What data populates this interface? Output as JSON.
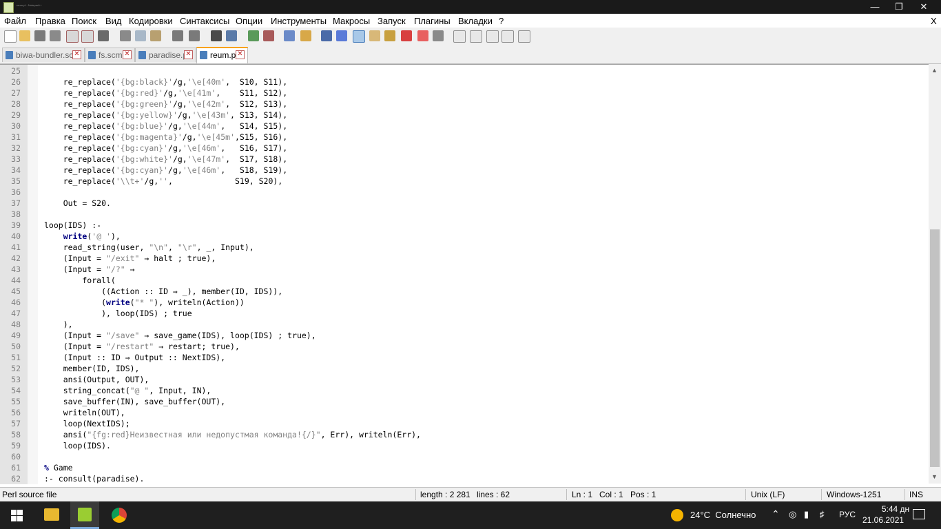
{
  "window": {
    "title": "reum.pl - Notepad++"
  },
  "menu": [
    "Файл",
    "Правка",
    "Поиск",
    "Вид",
    "Кодировки",
    "Синтаксисы",
    "Опции",
    "Инструменты",
    "Макросы",
    "Запуск",
    "Плагины",
    "Вкладки",
    "?"
  ],
  "menu_close": "X",
  "tabs": [
    {
      "label": "biwa-bundler.scm"
    },
    {
      "label": "fs.scm"
    },
    {
      "label": "paradise.pl"
    },
    {
      "label": "reum.pl"
    }
  ],
  "lines": [
    {
      "n": "25",
      "h": ""
    },
    {
      "n": "26",
      "h": "    re_replace(<span class=\"s\">'{bg:black}'</span>/g,<span class=\"s\">'\\e[40m'</span>,  S10, S11),"
    },
    {
      "n": "27",
      "h": "    re_replace(<span class=\"s\">'{bg:red}'</span>/g,<span class=\"s\">'\\e[41m'</span>,    S11, S12),"
    },
    {
      "n": "28",
      "h": "    re_replace(<span class=\"s\">'{bg:green}'</span>/g,<span class=\"s\">'\\e[42m'</span>,  S12, S13),"
    },
    {
      "n": "29",
      "h": "    re_replace(<span class=\"s\">'{bg:yellow}'</span>/g,<span class=\"s\">'\\e[43m'</span>, S13, S14),"
    },
    {
      "n": "30",
      "h": "    re_replace(<span class=\"s\">'{bg:blue}'</span>/g,<span class=\"s\">'\\e[44m'</span>,   S14, S15),"
    },
    {
      "n": "31",
      "h": "    re_replace(<span class=\"s\">'{bg:magenta}'</span>/g,<span class=\"s\">'\\e[45m'</span>,S15, S16),"
    },
    {
      "n": "32",
      "h": "    re_replace(<span class=\"s\">'{bg:cyan}'</span>/g,<span class=\"s\">'\\e[46m'</span>,   S16, S17),"
    },
    {
      "n": "33",
      "h": "    re_replace(<span class=\"s\">'{bg:white}'</span>/g,<span class=\"s\">'\\e[47m'</span>,  S17, S18),"
    },
    {
      "n": "34",
      "h": "    re_replace(<span class=\"s\">'{bg:cyan}'</span>/g,<span class=\"s\">'\\e[46m'</span>,   S18, S19),"
    },
    {
      "n": "35",
      "h": "    re_replace(<span class=\"s\">'\\\\t+'</span>/g,<span class=\"s\">''</span>,             S19, S20),"
    },
    {
      "n": "36",
      "h": ""
    },
    {
      "n": "37",
      "h": "    Out = S20."
    },
    {
      "n": "38",
      "h": ""
    },
    {
      "n": "39",
      "h": "loop(IDS) :-"
    },
    {
      "n": "40",
      "h": "    <span class=\"k\">write</span>(<span class=\"s\">'@ '</span>),"
    },
    {
      "n": "41",
      "h": "    read_string(user, <span class=\"s\">\"\\n\"</span>, <span class=\"s\">\"\\r\"</span>, _, Input),"
    },
    {
      "n": "42",
      "h": "    (Input = <span class=\"s\">\"/exit\"</span> → halt ; true),"
    },
    {
      "n": "43",
      "h": "    (Input = <span class=\"s\">\"/?\"</span> →"
    },
    {
      "n": "44",
      "h": "        forall("
    },
    {
      "n": "45",
      "h": "            ((Action :: ID ⇒ _), member(ID, IDS)),"
    },
    {
      "n": "46",
      "h": "            (<span class=\"k\">write</span>(<span class=\"s\">\"* \"</span>), writeln(Action))"
    },
    {
      "n": "47",
      "h": "            ), loop(IDS) ; true"
    },
    {
      "n": "48",
      "h": "    ),"
    },
    {
      "n": "49",
      "h": "    (Input = <span class=\"s\">\"/save\"</span> → save_game(IDS), loop(IDS) ; true),"
    },
    {
      "n": "50",
      "h": "    (Input = <span class=\"s\">\"/restart\"</span> → restart; true),"
    },
    {
      "n": "51",
      "h": "    (Input :: ID ⇒ Output :: NextIDS),"
    },
    {
      "n": "52",
      "h": "    member(ID, IDS),"
    },
    {
      "n": "53",
      "h": "    ansi(Output, OUT),"
    },
    {
      "n": "54",
      "h": "    string_concat(<span class=\"s\">\"@ \"</span>, Input, IN),"
    },
    {
      "n": "55",
      "h": "    save_buffer(IN), save_buffer(OUT),"
    },
    {
      "n": "56",
      "h": "    writeln(OUT),"
    },
    {
      "n": "57",
      "h": "    loop(NextIDS);"
    },
    {
      "n": "58",
      "h": "    ansi(<span class=\"s\">\"{fg:red}Неизвестная или недопустмая команда!{/}\"</span>, Err), writeln(Err),"
    },
    {
      "n": "59",
      "h": "    loop(IDS)."
    },
    {
      "n": "60",
      "h": ""
    },
    {
      "n": "61",
      "h": "<span class=\"k\">%</span> Game"
    },
    {
      "n": "62",
      "h": ":- consult(paradise)."
    }
  ],
  "status": {
    "type": "Perl source file",
    "length": "length : 2 281",
    "lines": "lines : 62",
    "ln": "Ln : 1",
    "col": "Col : 1",
    "pos": "Pos : 1",
    "eol": "Unix (LF)",
    "enc": "Windows-1251",
    "mode": "INS"
  },
  "taskbar": {
    "weather": "24°C  Солнечно",
    "lang": "РУС",
    "time": "5:44 дн",
    "date": "21.06.2021"
  },
  "colors": {
    "accent_tab": "#f9a200",
    "keyword": "#000080",
    "string": "#808080"
  }
}
